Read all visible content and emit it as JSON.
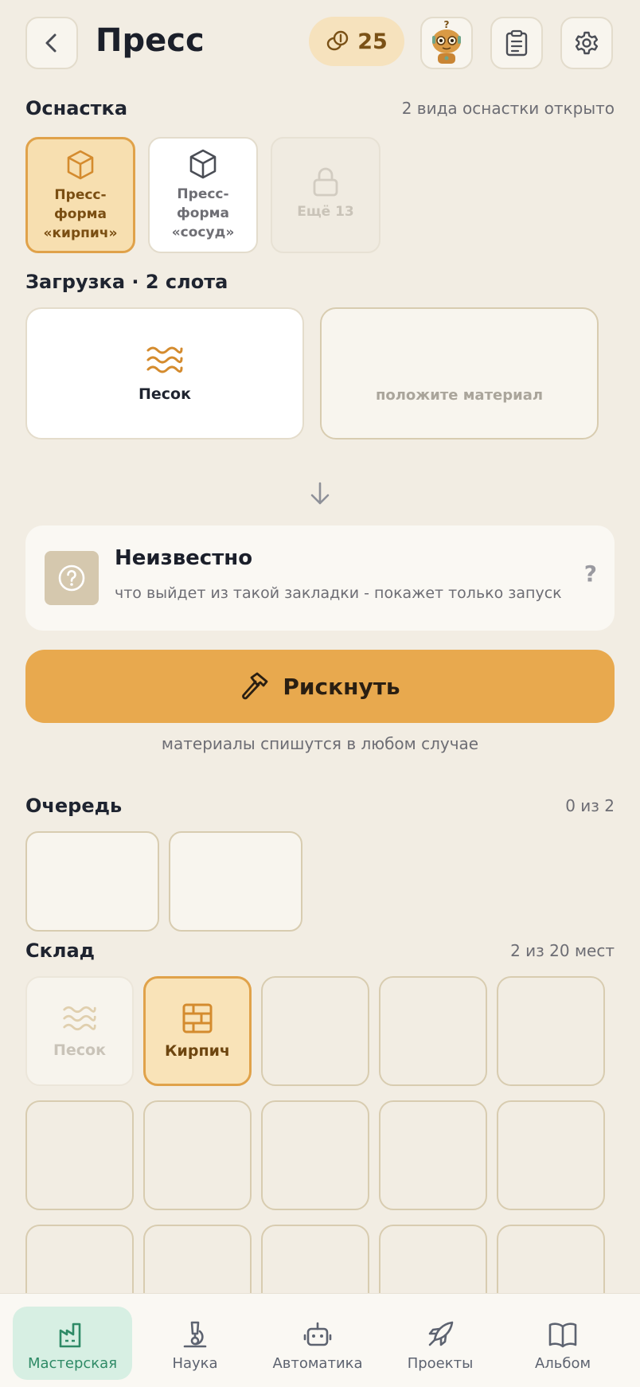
{
  "header": {
    "title": "Пресс",
    "coins": "25"
  },
  "tooling": {
    "title": "Оснастка",
    "meta": "2 вида оснастки открыто",
    "items": [
      {
        "label": "Пресс-\nформа\n«кирпич»"
      },
      {
        "label": "Пресс-\nформа\n«сосуд»"
      },
      {
        "label": "Ещё 13"
      }
    ]
  },
  "load": {
    "title": "Загрузка · 2 слота",
    "slots": [
      {
        "label": "Песок",
        "icon": "waves-icon"
      },
      {
        "placeholder": "положите материал"
      }
    ]
  },
  "result": {
    "title": "Неизвестно",
    "description": "что выйдет из такой закладки - покажет только запуск",
    "help": "?"
  },
  "action": {
    "label": "Рискнуть",
    "note": "материалы спишутся в любом случае"
  },
  "queue": {
    "title": "Очередь",
    "meta": "0 из 2"
  },
  "storage": {
    "title": "Склад",
    "meta": "2 из 20 мест",
    "items": [
      {
        "label": "Песок",
        "icon": "waves-icon"
      },
      {
        "label": "Кирпич",
        "icon": "brick-icon"
      }
    ]
  },
  "nav": {
    "items": [
      {
        "label": "Мастерская",
        "icon": "factory-icon"
      },
      {
        "label": "Наука",
        "icon": "microscope-icon"
      },
      {
        "label": "Автоматика",
        "icon": "robot-icon"
      },
      {
        "label": "Проекты",
        "icon": "rocket-icon"
      },
      {
        "label": "Альбом",
        "icon": "book-icon"
      }
    ]
  },
  "colors": {
    "background": "#f2ede3",
    "accent": "#e8a94e",
    "nav_active": "#2e8a66"
  }
}
